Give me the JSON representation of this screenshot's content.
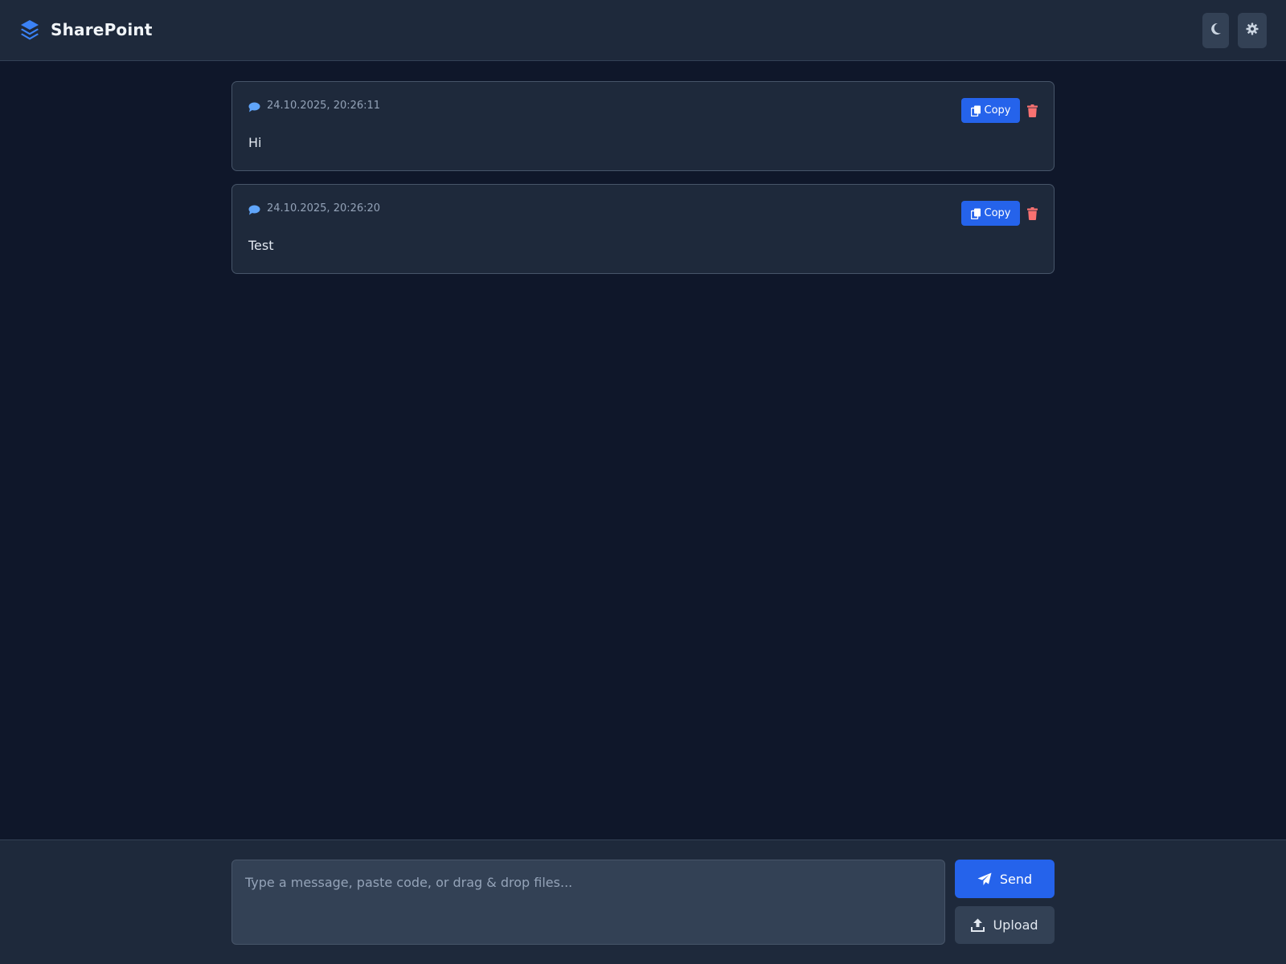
{
  "header": {
    "title": "SharePoint",
    "brand_icon": "layers-icon",
    "buttons": [
      {
        "icon": "moon-icon"
      },
      {
        "icon": "gear-icon"
      }
    ]
  },
  "messages": [
    {
      "timestamp": "24.10.2025, 20:26:11",
      "text": "Hi",
      "copy_label": "Copy"
    },
    {
      "timestamp": "24.10.2025, 20:26:20",
      "text": "Test",
      "copy_label": "Copy"
    }
  ],
  "composer": {
    "placeholder": "Type a message, paste code, or drag & drop files...",
    "value": "",
    "send_label": "Send",
    "upload_label": "Upload"
  },
  "colors": {
    "background": "#0f172a",
    "surface": "#1e293b",
    "accent": "#2563eb",
    "danger": "#f87171",
    "icon_accent": "#3b82f6"
  }
}
